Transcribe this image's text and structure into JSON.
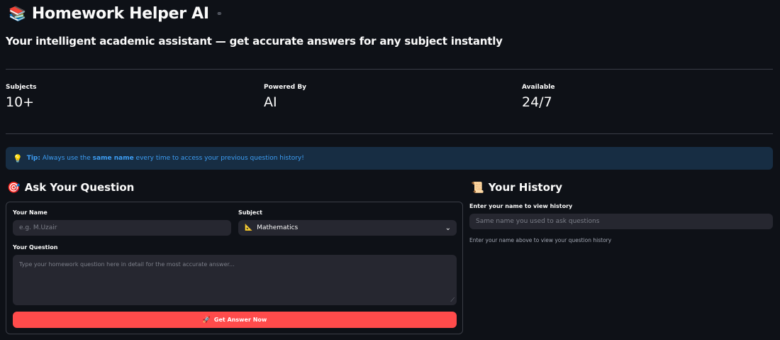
{
  "header": {
    "title": "Homework Helper AI",
    "title_emoji": "📚",
    "subtitle": "Your intelligent academic assistant — get accurate answers for any subject instantly"
  },
  "metrics": [
    {
      "label": "Subjects",
      "value": "10+"
    },
    {
      "label": "Powered By",
      "value": "AI"
    },
    {
      "label": "Available",
      "value": "24/7"
    }
  ],
  "tip": {
    "icon": "💡",
    "prefix": "Tip:",
    "text_before": " Always use the ",
    "emphasis": "same name",
    "text_after": " every time to access your previous question history!"
  },
  "ask": {
    "heading": "Ask Your Question",
    "heading_emoji": "🎯",
    "name_label": "Your Name",
    "name_placeholder": "e.g. M.Uzair",
    "subject_label": "Subject",
    "subject_icon": "📐",
    "subject_value": "Mathematics",
    "question_label": "Your Question",
    "question_placeholder": "Type your homework question here in detail for the most accurate answer...",
    "submit_icon": "🚀",
    "submit_label": "Get Answer Now"
  },
  "history": {
    "heading": "Your History",
    "heading_emoji": "📜",
    "input_label": "Enter your name to view history",
    "input_placeholder": "Same name you used to ask questions",
    "note": "Enter your name above to view your question history"
  },
  "colors": {
    "background": "#0e1117",
    "primary": "#ff4b4b",
    "info_bg": "#172d43",
    "info_text": "#3d9df3"
  }
}
